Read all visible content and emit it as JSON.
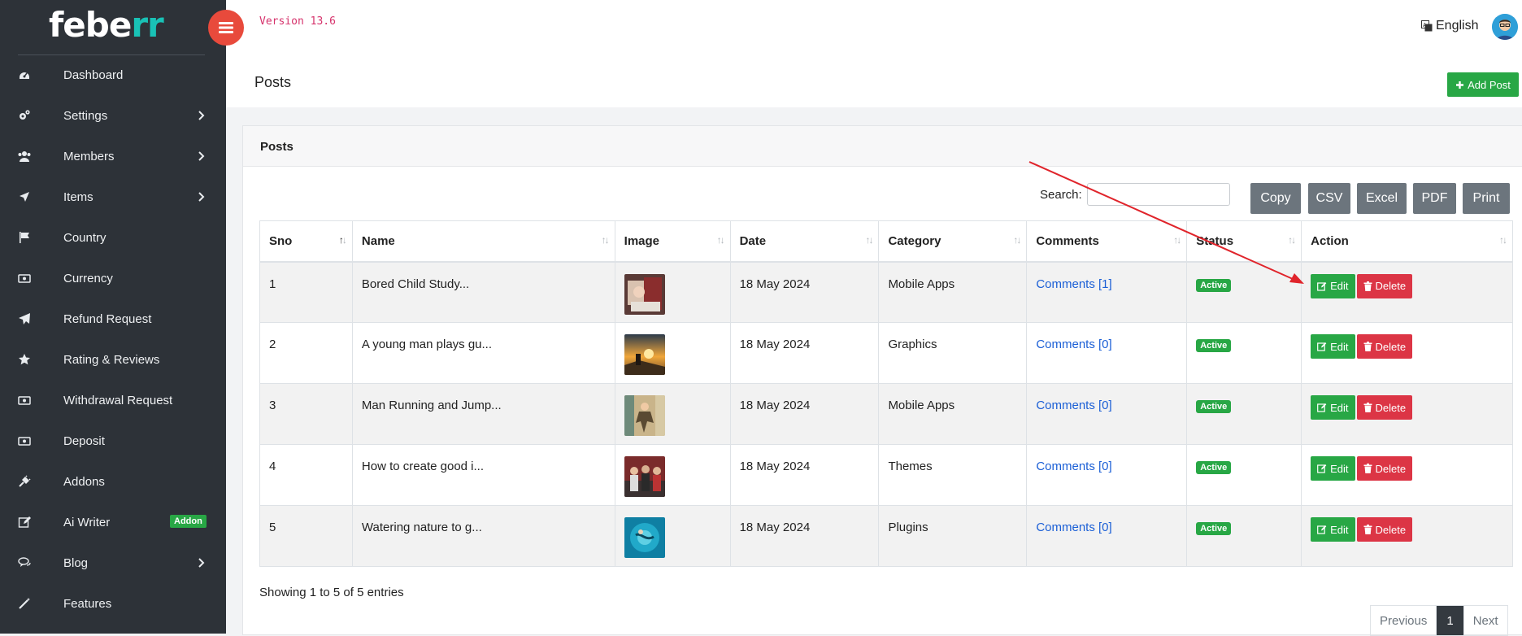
{
  "brand": {
    "logo_main": "febe",
    "logo_accent": "rr"
  },
  "topbar": {
    "version": "Version 13.6",
    "language": "English"
  },
  "sidebar": {
    "items": [
      {
        "label": "Dashboard"
      },
      {
        "label": "Settings"
      },
      {
        "label": "Members"
      },
      {
        "label": "Items"
      },
      {
        "label": "Country"
      },
      {
        "label": "Currency"
      },
      {
        "label": "Refund Request"
      },
      {
        "label": "Rating & Reviews"
      },
      {
        "label": "Withdrawal Request"
      },
      {
        "label": "Deposit"
      },
      {
        "label": "Addons"
      },
      {
        "label": "Ai Writer",
        "badge": "Addon"
      },
      {
        "label": "Blog"
      },
      {
        "label": "Features"
      }
    ]
  },
  "page": {
    "title": "Posts",
    "add_label": "Add Post"
  },
  "card": {
    "title": "Posts",
    "search_label": "Search:",
    "search_value": "",
    "export_buttons": [
      "Copy",
      "CSV",
      "Excel",
      "PDF",
      "Print"
    ],
    "columns": [
      "Sno",
      "Name",
      "Image",
      "Date",
      "Category",
      "Comments",
      "Status",
      "Action"
    ],
    "rows": [
      {
        "sno": "1",
        "name": "Bored Child Study...",
        "date": "18 May 2024",
        "category": "Mobile Apps",
        "comments": "Comments [1]",
        "status": "Active"
      },
      {
        "sno": "2",
        "name": "A young man plays gu...",
        "date": "18 May 2024",
        "category": "Graphics",
        "comments": "Comments [0]",
        "status": "Active"
      },
      {
        "sno": "3",
        "name": "Man Running and Jump...",
        "date": "18 May 2024",
        "category": "Mobile Apps",
        "comments": "Comments [0]",
        "status": "Active"
      },
      {
        "sno": "4",
        "name": "How to create good i...",
        "date": "18 May 2024",
        "category": "Themes",
        "comments": "Comments [0]",
        "status": "Active"
      },
      {
        "sno": "5",
        "name": "Watering nature to g...",
        "date": "18 May 2024",
        "category": "Plugins",
        "comments": "Comments [0]",
        "status": "Active"
      }
    ],
    "edit_label": "Edit",
    "delete_label": "Delete",
    "showing": "Showing 1 to 5 of 5 entries",
    "pagination": {
      "prev": "Previous",
      "current": "1",
      "next": "Next"
    }
  },
  "colors": {
    "sidebar": "#2d3238",
    "accent": "#19c2b6",
    "success": "#28a745",
    "danger": "#dc3545",
    "toggle": "#e84a3c",
    "annotation": "#e0242b"
  }
}
